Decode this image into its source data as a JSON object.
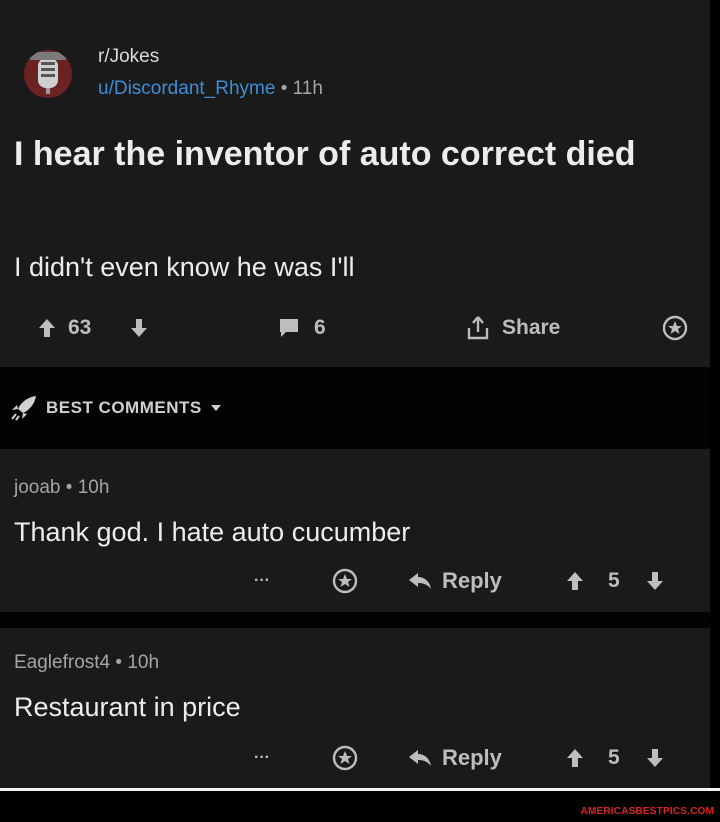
{
  "post": {
    "subreddit": "r/Jokes",
    "author": "u/Discordant_Rhyme",
    "separator": "•",
    "time": "11h",
    "title": "I hear the inventor of auto correct died",
    "body": "I didn't even know he was I'll",
    "upvotes": "63",
    "comments": "6",
    "share_label": "Share"
  },
  "sort": {
    "label": "BEST COMMENTS"
  },
  "comments": [
    {
      "author": "jooab",
      "separator": "•",
      "time": "10h",
      "text": "Thank god. I hate auto cucumber",
      "more": "···",
      "reply_label": "Reply",
      "score": "5"
    },
    {
      "author": "Eaglefrost4",
      "separator": "•",
      "time": "10h",
      "text": "Restaurant in price",
      "more": "···",
      "reply_label": "Reply",
      "score": "5"
    }
  ],
  "watermark": "AMERICASBESTPICS.COM",
  "colors": {
    "background": "#1a1a1b",
    "username": "#3d8ed6",
    "watermark": "#d92424"
  }
}
